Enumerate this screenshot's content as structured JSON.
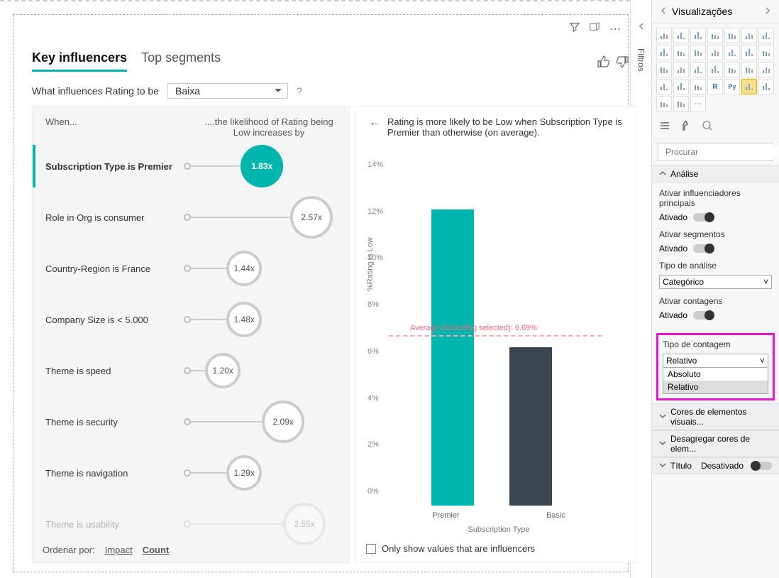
{
  "canvas": {
    "toolbar": {
      "filter": "⧩",
      "focus": "⧉",
      "more": "⋯"
    }
  },
  "visual": {
    "tabs": {
      "key_influencers": "Key influencers",
      "top_segments": "Top segments"
    },
    "thumbs_up": "👍",
    "thumbs_down": "👎",
    "question_prefix": "What influences Rating to be",
    "dropdown_value": "Baixa",
    "help": "?",
    "left_header": {
      "when": "When...",
      "likelihood": "....the likelihood of Rating being Low increases by"
    },
    "influencers": [
      {
        "label": "Subscription Type is Premier",
        "value": "1.83x",
        "selected": true,
        "pos": 80,
        "size": "big"
      },
      {
        "label": "Role in Org is consumer",
        "value": "2.57x",
        "selected": false,
        "pos": 150,
        "size": "big"
      },
      {
        "label": "Country-Region is France",
        "value": "1.44x",
        "selected": false,
        "pos": 60,
        "size": ""
      },
      {
        "label": "Company Size is < 5.000",
        "value": "1.48x",
        "selected": false,
        "pos": 60,
        "size": ""
      },
      {
        "label": "Theme is speed",
        "value": "1.20x",
        "selected": false,
        "pos": 30,
        "size": ""
      },
      {
        "label": "Theme is security",
        "value": "2.09x",
        "selected": false,
        "pos": 110,
        "size": "big"
      },
      {
        "label": "Theme is navigation",
        "value": "1.29x",
        "selected": false,
        "pos": 60,
        "size": ""
      },
      {
        "label": "Theme is usability",
        "value": "2.55x",
        "selected": false,
        "pos": 140,
        "size": "big",
        "faded": true
      }
    ],
    "sort": {
      "prefix": "Ordenar por:",
      "impact": "Impact",
      "count": "Count"
    },
    "detail": {
      "back": "←",
      "text": "Rating is more likely to be Low when Subscription Type is Premier than otherwise (on average).",
      "y_axis_label": "%Rating is Low",
      "x_axis_label": "Subscription Type",
      "avg_label": "Average (excluding selected): 6.69%",
      "checkbox_label": "Only show values that are influencers"
    }
  },
  "chart_data": {
    "type": "bar",
    "categories": [
      "Premier",
      "Basic"
    ],
    "values": [
      12.7,
      6.8
    ],
    "avg_line": 6.69,
    "avg_label": "Average (excluding selected): 6.69%",
    "ylim": [
      0,
      14
    ],
    "y_ticks": [
      0,
      2,
      4,
      6,
      8,
      10,
      12,
      14
    ],
    "ylabel": "%Rating is Low",
    "xlabel": "Subscription Type",
    "colors": [
      "#00b5ad",
      "#3a4750"
    ]
  },
  "rail": {
    "filters": "Filtros"
  },
  "panel": {
    "title": "Visualizações",
    "search_placeholder": "Procurar",
    "analysis": {
      "header": "Análise",
      "enable_ki": "Ativar influenciadores principais",
      "enable_seg": "Ativar segmentos",
      "analysis_type": "Tipo de análise",
      "analysis_type_value": "Categórico",
      "enable_counts": "Ativar contagens",
      "count_type": "Tipo de contagem",
      "count_type_value": "Relativo",
      "count_options": {
        "absolute": "Absoluto",
        "relative": "Relativo"
      },
      "on": "Ativado",
      "off": "Desativado"
    },
    "sections": {
      "colors": "Cores de elementos visuais...",
      "drill": "Desagregar cores de elem...",
      "title": "Título"
    }
  }
}
